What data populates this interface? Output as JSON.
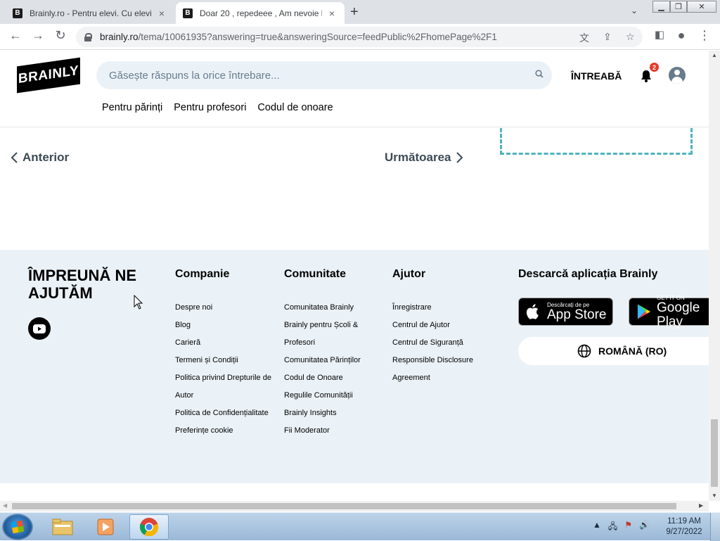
{
  "browser": {
    "tabs": [
      {
        "favicon": "B",
        "title": "Brainly.ro - Pentru elevi. Cu elevi."
      },
      {
        "favicon": "B",
        "title": "Doar 20 , repedeee , Am nevoie l"
      }
    ],
    "new_tab_symbol": "+",
    "close_symbol": "×",
    "url_host": "brainly.ro",
    "url_path": "/tema/10061935?answering=true&answeringSource=feedPublic%2FhomePage%2F1"
  },
  "header": {
    "logo_text": "BRAINLY",
    "search_placeholder": "Găsește răspuns la orice întrebare...",
    "ask_label": "ÎNTREABĂ",
    "notification_count": "2"
  },
  "subnav": [
    "Pentru părinți",
    "Pentru profesori",
    "Codul de onoare"
  ],
  "pagination": {
    "prev_label": "Anterior",
    "next_label": "Următoarea"
  },
  "footer": {
    "slogan": "ÎMPREUNĂ NE AJUTĂM",
    "columns": [
      {
        "title": "Companie",
        "links": [
          "Despre noi",
          "Blog",
          "Carieră",
          "Termeni și Condiții",
          "Politica privind Drepturile de Autor",
          "Politica de Confidențialitate",
          "Preferințe cookie"
        ]
      },
      {
        "title": "Comunitate",
        "links": [
          "Comunitatea Brainly",
          "Brainly pentru Școli & Profesori",
          "Comunitatea Părinților",
          "Codul de Onoare",
          "Regulile Comunității",
          "Brainly Insights",
          "Fii Moderator"
        ]
      },
      {
        "title": "Ajutor",
        "links": [
          "Înregistrare",
          "Centrul de Ajutor",
          "Centrul de Siguranță",
          "Responsible Disclosure Agreement"
        ]
      }
    ],
    "download_title": "Descarcă aplicația Brainly",
    "app_store": {
      "small": "Descărcați de pe",
      "big": "App Store"
    },
    "google_play": {
      "small": "GET IT ON",
      "big": "Google Play"
    },
    "language": "ROMÂNĂ (RO)"
  },
  "taskbar": {
    "time": "11:19 AM",
    "date": "9/27/2022"
  },
  "colors": {
    "footer_bg": "#ebf2f7",
    "search_bg": "#ebf2f7",
    "badge": "#e8382b",
    "dashed_border": "#4fb3bf"
  }
}
